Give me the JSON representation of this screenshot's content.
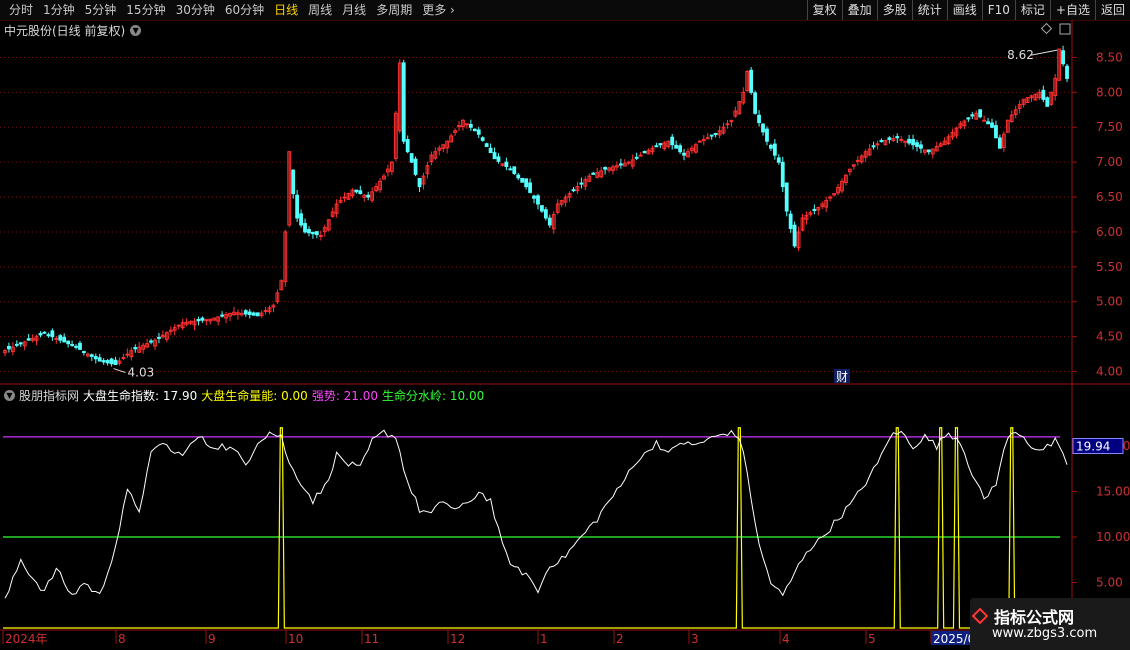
{
  "toolbar": {
    "periods": [
      "分时",
      "1分钟",
      "5分钟",
      "15分钟",
      "30分钟",
      "60分钟",
      "日线",
      "周线",
      "月线",
      "多周期",
      "更多"
    ],
    "active_period": "日线",
    "buttons": [
      "复权",
      "叠加",
      "多股",
      "统计",
      "画线",
      "F10",
      "标记",
      "+自选",
      "返回"
    ]
  },
  "stock": {
    "title": "中元股份(日线 前复权)",
    "high_label": "8.62",
    "low_label": "4.03",
    "event_marker": "财"
  },
  "price_axis": {
    "ticks": [
      "8.50",
      "8.00",
      "7.50",
      "7.00",
      "6.50",
      "6.00",
      "5.50",
      "5.00",
      "4.50",
      "4.00"
    ]
  },
  "indicator": {
    "source": "股朋指标网",
    "items": [
      {
        "label": "大盘生命指数: 17.90",
        "color": "#ffffff"
      },
      {
        "label": "大盘生命量能: 0.00",
        "color": "#ffff00"
      },
      {
        "label": "强势: 21.00",
        "color": "#ff44ff"
      },
      {
        "label": "生命分水岭: 10.00",
        "color": "#33ff33"
      }
    ],
    "axis_ticks": [
      "20.00",
      "15.00",
      "10.00",
      "5.00"
    ],
    "current_value_badge": "19.94",
    "strong_level": 21.0,
    "watershed_level": 10.0
  },
  "time_axis": {
    "labels": [
      "2024年",
      "8",
      "9",
      "10",
      "11",
      "12",
      "1",
      "2",
      "3",
      "4",
      "5",
      "2025/05"
    ]
  },
  "watermark": {
    "main": "指标公式网",
    "sub": "www.zbgs3.com"
  },
  "colors": {
    "up": "#ff3030",
    "down": "#54ffff",
    "grid": "#7a1010",
    "axis": "#9a1010",
    "index_line": "#ffffff",
    "volume_line": "#ffff00",
    "strong_line": "#cc33ff",
    "watershed_line": "#33ff33"
  },
  "chart_data": {
    "type": "candlestick",
    "ylim": [
      3.85,
      8.75
    ],
    "price_anchors": [
      [
        0,
        4.3
      ],
      [
        10,
        4.55
      ],
      [
        18,
        4.35
      ],
      [
        24,
        4.15
      ],
      [
        28,
        4.1
      ],
      [
        32,
        4.3
      ],
      [
        38,
        4.45
      ],
      [
        45,
        4.7
      ],
      [
        52,
        4.75
      ],
      [
        58,
        4.85
      ],
      [
        64,
        4.8
      ],
      [
        68,
        4.95
      ],
      [
        70,
        5.3
      ],
      [
        71,
        6.0
      ],
      [
        72,
        6.9
      ],
      [
        74,
        6.2
      ],
      [
        76,
        6.0
      ],
      [
        80,
        5.95
      ],
      [
        84,
        6.4
      ],
      [
        88,
        6.6
      ],
      [
        92,
        6.5
      ],
      [
        96,
        6.8
      ],
      [
        98,
        7.0
      ],
      [
        100,
        8.4
      ],
      [
        101,
        7.3
      ],
      [
        103,
        7.0
      ],
      [
        105,
        6.65
      ],
      [
        108,
        7.1
      ],
      [
        112,
        7.3
      ],
      [
        116,
        7.6
      ],
      [
        120,
        7.4
      ],
      [
        124,
        7.05
      ],
      [
        128,
        6.9
      ],
      [
        132,
        6.65
      ],
      [
        135,
        6.4
      ],
      [
        138,
        6.1
      ],
      [
        140,
        6.4
      ],
      [
        144,
        6.6
      ],
      [
        148,
        6.8
      ],
      [
        152,
        6.9
      ],
      [
        158,
        7.0
      ],
      [
        164,
        7.2
      ],
      [
        168,
        7.3
      ],
      [
        172,
        7.1
      ],
      [
        176,
        7.3
      ],
      [
        180,
        7.4
      ],
      [
        184,
        7.6
      ],
      [
        187,
        8.0
      ],
      [
        188,
        8.3
      ],
      [
        190,
        7.7
      ],
      [
        193,
        7.3
      ],
      [
        196,
        7.0
      ],
      [
        198,
        6.3
      ],
      [
        200,
        5.8
      ],
      [
        202,
        6.2
      ],
      [
        206,
        6.35
      ],
      [
        210,
        6.55
      ],
      [
        214,
        6.9
      ],
      [
        218,
        7.15
      ],
      [
        222,
        7.3
      ],
      [
        226,
        7.35
      ],
      [
        230,
        7.25
      ],
      [
        234,
        7.15
      ],
      [
        238,
        7.3
      ],
      [
        242,
        7.55
      ],
      [
        246,
        7.7
      ],
      [
        250,
        7.5
      ],
      [
        252,
        7.2
      ],
      [
        254,
        7.6
      ],
      [
        258,
        7.9
      ],
      [
        262,
        8.0
      ],
      [
        264,
        7.8
      ],
      [
        266,
        8.2
      ],
      [
        267,
        8.62
      ],
      [
        269,
        8.2
      ]
    ],
    "index_anchors": [
      [
        0,
        3
      ],
      [
        4,
        7.5
      ],
      [
        7,
        5.5
      ],
      [
        10,
        4
      ],
      [
        13,
        6.5
      ],
      [
        17,
        3.5
      ],
      [
        20,
        5
      ],
      [
        24,
        3.5
      ],
      [
        28,
        9
      ],
      [
        31,
        15
      ],
      [
        34,
        13
      ],
      [
        37,
        19
      ],
      [
        40,
        20.5
      ],
      [
        43,
        19
      ],
      [
        46,
        19.5
      ],
      [
        49,
        21
      ],
      [
        52,
        20
      ],
      [
        55,
        20
      ],
      [
        58,
        19.5
      ],
      [
        61,
        18
      ],
      [
        64,
        20.5
      ],
      [
        67,
        21.5
      ],
      [
        70,
        21
      ],
      [
        72,
        18
      ],
      [
        75,
        16
      ],
      [
        78,
        14
      ],
      [
        81,
        15.5
      ],
      [
        84,
        19
      ],
      [
        87,
        18
      ],
      [
        90,
        17.5
      ],
      [
        93,
        20.5
      ],
      [
        96,
        21.5
      ],
      [
        99,
        21
      ],
      [
        102,
        16
      ],
      [
        105,
        13
      ],
      [
        108,
        12.5
      ],
      [
        111,
        14
      ],
      [
        114,
        13
      ],
      [
        117,
        13.5
      ],
      [
        120,
        15
      ],
      [
        123,
        14
      ],
      [
        126,
        9
      ],
      [
        129,
        6.5
      ],
      [
        132,
        6
      ],
      [
        135,
        4
      ],
      [
        138,
        7
      ],
      [
        141,
        7.5
      ],
      [
        144,
        9
      ],
      [
        147,
        10.5
      ],
      [
        150,
        12
      ],
      [
        153,
        14
      ],
      [
        156,
        15.5
      ],
      [
        159,
        18
      ],
      [
        162,
        19
      ],
      [
        165,
        20.5
      ],
      [
        168,
        19
      ],
      [
        171,
        20.5
      ],
      [
        174,
        20
      ],
      [
        177,
        20.5
      ],
      [
        180,
        21
      ],
      [
        183,
        21.5
      ],
      [
        186,
        21
      ],
      [
        188,
        17
      ],
      [
        191,
        9
      ],
      [
        194,
        5
      ],
      [
        197,
        3.5
      ],
      [
        200,
        6
      ],
      [
        203,
        8.5
      ],
      [
        206,
        9.5
      ],
      [
        209,
        11
      ],
      [
        212,
        12.5
      ],
      [
        215,
        14
      ],
      [
        218,
        16
      ],
      [
        221,
        18
      ],
      [
        224,
        21
      ],
      [
        227,
        21.5
      ],
      [
        230,
        20
      ],
      [
        233,
        21
      ],
      [
        236,
        20
      ],
      [
        239,
        21.5
      ],
      [
        242,
        20.5
      ],
      [
        245,
        17
      ],
      [
        248,
        14
      ],
      [
        251,
        16
      ],
      [
        254,
        21
      ],
      [
        257,
        21.5
      ],
      [
        260,
        20
      ],
      [
        263,
        19.5
      ],
      [
        266,
        20.5
      ],
      [
        269,
        18
      ]
    ],
    "volume_pulses": [
      70,
      186,
      226,
      237,
      241,
      255
    ],
    "indicator_ylim": [
      0,
      24.5
    ]
  }
}
